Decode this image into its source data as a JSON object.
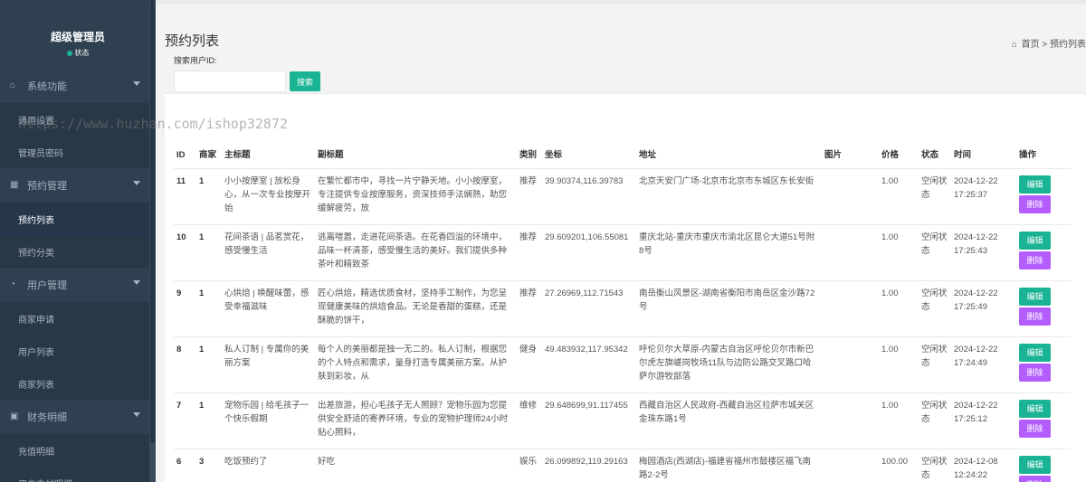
{
  "sidebar": {
    "user_name": "超级管理员",
    "user_status": "状态",
    "status_color": "#1ab394",
    "groups": [
      {
        "label": "系统功能",
        "icon": "home-icon",
        "items": [
          "通用设置",
          "管理员密码"
        ]
      },
      {
        "label": "预约管理",
        "icon": "table-icon",
        "items": [
          "预约列表",
          "预约分类"
        ]
      },
      {
        "label": "用户管理",
        "icon": "pie-chart-icon",
        "items": [
          "商家申请",
          "用户列表",
          "商家列表"
        ]
      },
      {
        "label": "财务明细",
        "icon": "money-icon",
        "items": [
          "充值明细",
          "用户支付明细"
        ]
      }
    ]
  },
  "header": {
    "page_title": "预约列表",
    "breadcrumb_home": "首页",
    "breadcrumb_sep": ">",
    "breadcrumb_current": "预约列表"
  },
  "search": {
    "label": "搜索用户ID:",
    "value": "",
    "placeholder": "",
    "button_label": "搜索"
  },
  "watermark": "https://www.huzhan.com/ishop32872",
  "table": {
    "columns": [
      "ID",
      "商家",
      "主标题",
      "副标题",
      "类别",
      "坐标",
      "地址",
      "图片",
      "价格",
      "状态",
      "时间",
      "操作"
    ],
    "edit_label": "编辑",
    "delete_label": "删除",
    "rows": [
      {
        "id": "11",
        "shop": "1",
        "title": "小小按摩室 | 放松身心，从一次专业按摩开始",
        "subtitle": "在繁忙都市中，寻找一片宁静天地。小小按摩室，专注提供专业按摩服务，资深技师手法娴熟，助您缓解疲劳，放",
        "category": "推荐",
        "coords": "39.90374,116.39783",
        "address": "北京天安门广场-北京市北京市东城区东长安街",
        "image": "",
        "price": "1.00",
        "status": "空闲状态",
        "time": "2024-12-22 17:25:37"
      },
      {
        "id": "10",
        "shop": "1",
        "title": "花间茶语 | 品茗赏花，感受慢生活",
        "subtitle": "逃离喧嚣，走进花间茶语。在花香四溢的环境中，品味一杯清茶，感受慢生活的美好。我们提供多种茶叶和精致茶",
        "category": "推荐",
        "coords": "29.609201,106.55081",
        "address": "重庆北站-重庆市重庆市渝北区昆仑大道51号附8号",
        "image": "",
        "price": "1.00",
        "status": "空闲状态",
        "time": "2024-12-22 17:25:43"
      },
      {
        "id": "9",
        "shop": "1",
        "title": "心烘焙 | 唤醒味蕾，感受幸福滋味",
        "subtitle": "匠心烘焙，精选优质食材，坚持手工制作，为您呈现健康美味的烘焙食品。无论是香甜的蛋糕，还是酥脆的饼干，",
        "category": "推荐",
        "coords": "27.26969,112.71543",
        "address": "南岳衡山风景区-湖南省衡阳市南岳区金沙路72号",
        "image": "",
        "price": "1.00",
        "status": "空闲状态",
        "time": "2024-12-22 17:25:49"
      },
      {
        "id": "8",
        "shop": "1",
        "title": "私人订制 | 专属你的美丽方案",
        "subtitle": "每个人的美丽都是独一无二的。私人订制，根据您的个人特点和需求，量身打造专属美丽方案。从护肤到彩妆，从",
        "category": "健身",
        "coords": "49.483932,117.95342",
        "address": "呼伦贝尔大草原-内蒙古自治区呼伦贝尔市新巴尔虎左旗嵯岗牧场11队与边防公路交叉路口哈萨尔游牧部落",
        "image": "",
        "price": "1.00",
        "status": "空闲状态",
        "time": "2024-12-22 17:24:49"
      },
      {
        "id": "7",
        "shop": "1",
        "title": "宠物乐园 | 给毛孩子一个快乐假期",
        "subtitle": "出差旅游，担心毛孩子无人照顾？宠物乐园为您提供安全舒适的寄养环境，专业的宠物护理师24小时贴心照料，",
        "category": "维修",
        "coords": "29.648699,91.117455",
        "address": "西藏自治区人民政府-西藏自治区拉萨市城关区金珠东路1号",
        "image": "",
        "price": "1.00",
        "status": "空闲状态",
        "time": "2024-12-22 17:25:12"
      },
      {
        "id": "6",
        "shop": "3",
        "title": "吃饭预约了",
        "subtitle": "好吃",
        "category": "娱乐",
        "coords": "26.099892,119.29163",
        "address": "梅园酒店(西湖店)-福建省福州市鼓楼区福飞南路2-2号",
        "image": "",
        "price": "100.00",
        "status": "空闲状态",
        "time": "2024-12-08 12:24:22"
      }
    ]
  }
}
